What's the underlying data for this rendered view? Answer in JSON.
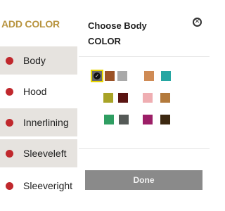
{
  "sidebar": {
    "title": "ADD COLOR",
    "items": [
      {
        "label": "Body",
        "active": true
      },
      {
        "label": "Hood",
        "active": false
      },
      {
        "label": "Innerlining",
        "active": true
      },
      {
        "label": "Sleeveleft",
        "active": true
      },
      {
        "label": "Sleeveright",
        "active": false
      }
    ],
    "dot_color": "#c0282d"
  },
  "panel": {
    "title_line1": "Choose Body",
    "title_line2": "COLOR",
    "close_icon": "close-circle-icon",
    "swatches": [
      {
        "color": "#6a6a6a",
        "selected": true
      },
      {
        "color": "#9b5226",
        "selected": false
      },
      {
        "color": "#a9a9a9",
        "selected": false
      },
      {
        "color": "#cf8b55",
        "selected": false
      },
      {
        "color": "#26a6a2",
        "selected": false
      },
      {
        "color": "#a8a326",
        "selected": false
      },
      {
        "color": "#5a1412",
        "selected": false
      },
      {
        "color": "#efaeb2",
        "selected": false
      },
      {
        "color": "#b37a3c",
        "selected": false
      },
      {
        "color": "#2f9e62",
        "selected": false
      },
      {
        "color": "#555a57",
        "selected": false
      },
      {
        "color": "#9c1f67",
        "selected": false
      },
      {
        "color": "#3c2811",
        "selected": false
      }
    ],
    "done_label": "Done"
  }
}
